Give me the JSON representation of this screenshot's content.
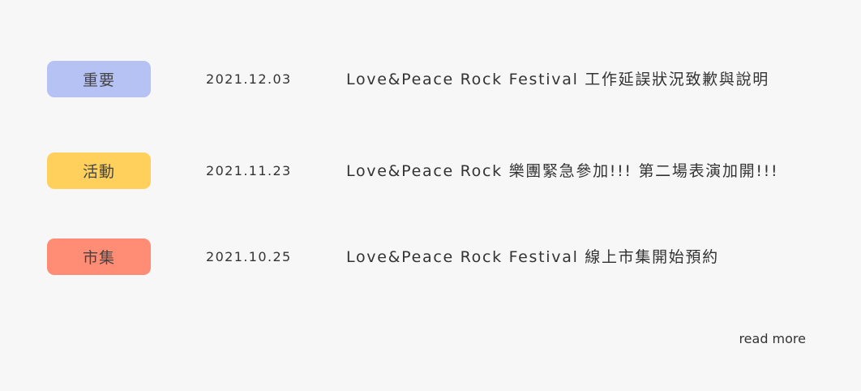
{
  "news": [
    {
      "tag": "重要",
      "tag_color": "#b6c1f4",
      "date": "2021.12.03",
      "title": "Love&Peace Rock Festival 工作延誤狀況致歉與說明"
    },
    {
      "tag": "活動",
      "tag_color": "#ffd15c",
      "date": "2021.11.23",
      "title": "Love&Peace Rock 樂團緊急參加!!! 第二場表演加開!!!"
    },
    {
      "tag": "市集",
      "tag_color": "#ff8c74",
      "date": "2021.10.25",
      "title": "Love&Peace Rock Festival 線上市集開始預約"
    }
  ],
  "read_more_label": "read more"
}
